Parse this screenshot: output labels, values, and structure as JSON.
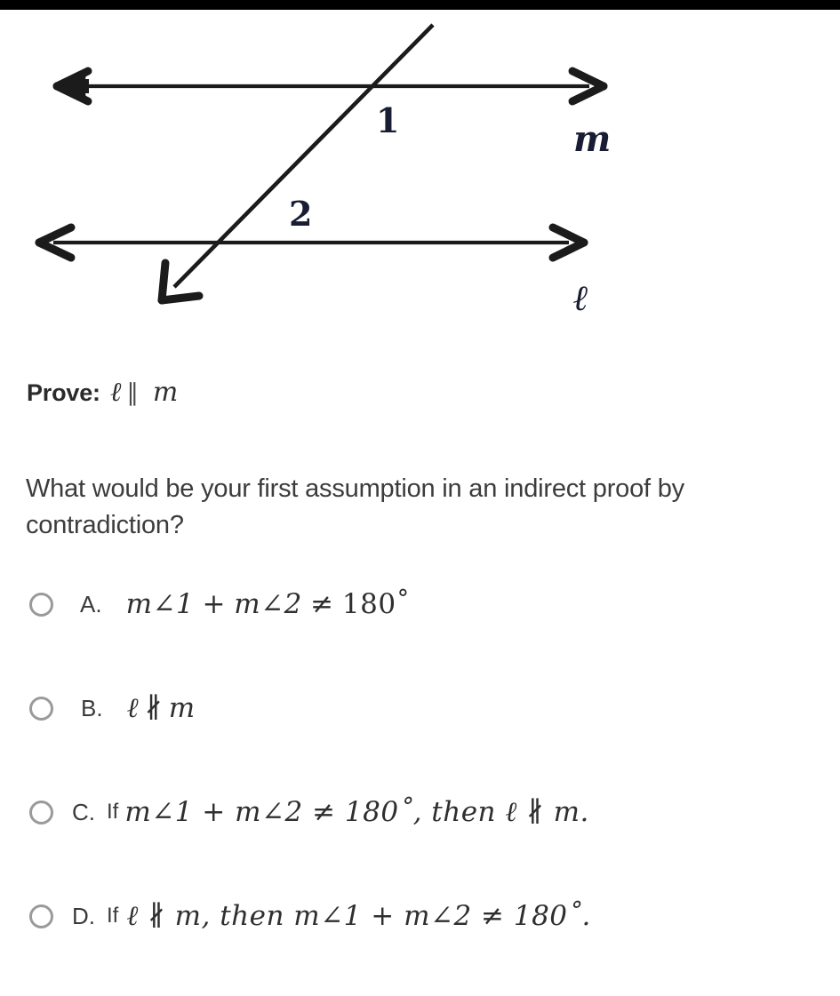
{
  "figure": {
    "name": "parallel-lines-transversal",
    "labels": {
      "angle_1": "1",
      "angle_2": "2",
      "line_m": "m",
      "line_l": "ℓ"
    },
    "stroke_color": "#1b1b1b",
    "label_color": "#191d33"
  },
  "prove": {
    "label": "Prove:",
    "line_a": "ℓ",
    "parallel_symbol": "∥",
    "line_b": "m"
  },
  "question": {
    "text": "What would be your first assumption in an indirect proof by contradiction?"
  },
  "options": [
    {
      "letter": "A.",
      "prefix": "",
      "m1": "m∠1",
      "plus": "+",
      "m2": "m∠2",
      "neq": "≠",
      "deg": "180˚",
      "body": "m∠1 + m∠2 ≠ 180˚",
      "selected": false
    },
    {
      "letter": "B.",
      "prefix": "",
      "body": "ℓ ∦ m",
      "line_a": "ℓ",
      "nparallel": "∦",
      "line_b": "m",
      "selected": false
    },
    {
      "letter": "C.",
      "prefix": "If",
      "body": "m∠1 + m∠2 ≠ 180˚, then ℓ ∦ m.",
      "selected": false
    },
    {
      "letter": "D.",
      "prefix": "If",
      "body": "ℓ ∦ m, then m∠1 + m∠2 ≠ 180˚.",
      "selected": false
    }
  ],
  "colors": {
    "background": "#ffffff",
    "text": "#3a3a3a",
    "radio_border": "#9a9a9a",
    "top_band": "#000000"
  }
}
